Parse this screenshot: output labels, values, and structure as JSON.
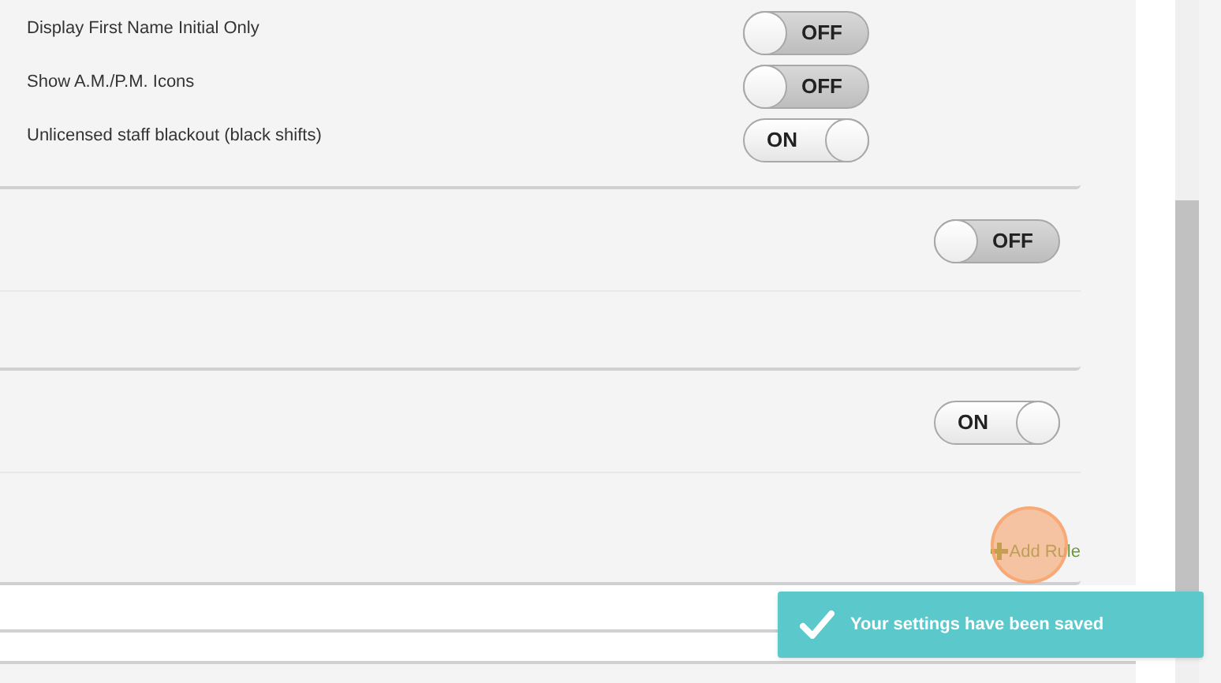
{
  "settings": [
    {
      "label": "Display First Name Initial Only",
      "on": false,
      "toggle_text": "OFF"
    },
    {
      "label": "Show A.M./P.M. Icons",
      "on": false,
      "toggle_text": "OFF"
    },
    {
      "label": "Unlicensed staff blackout (black shifts)",
      "on": true,
      "toggle_text": "ON"
    }
  ],
  "sections": [
    {
      "on": false,
      "toggle_text": "OFF"
    },
    {
      "on": true,
      "toggle_text": "ON",
      "action": "Add Rule"
    }
  ],
  "toast": {
    "message": "Your settings have been saved"
  }
}
